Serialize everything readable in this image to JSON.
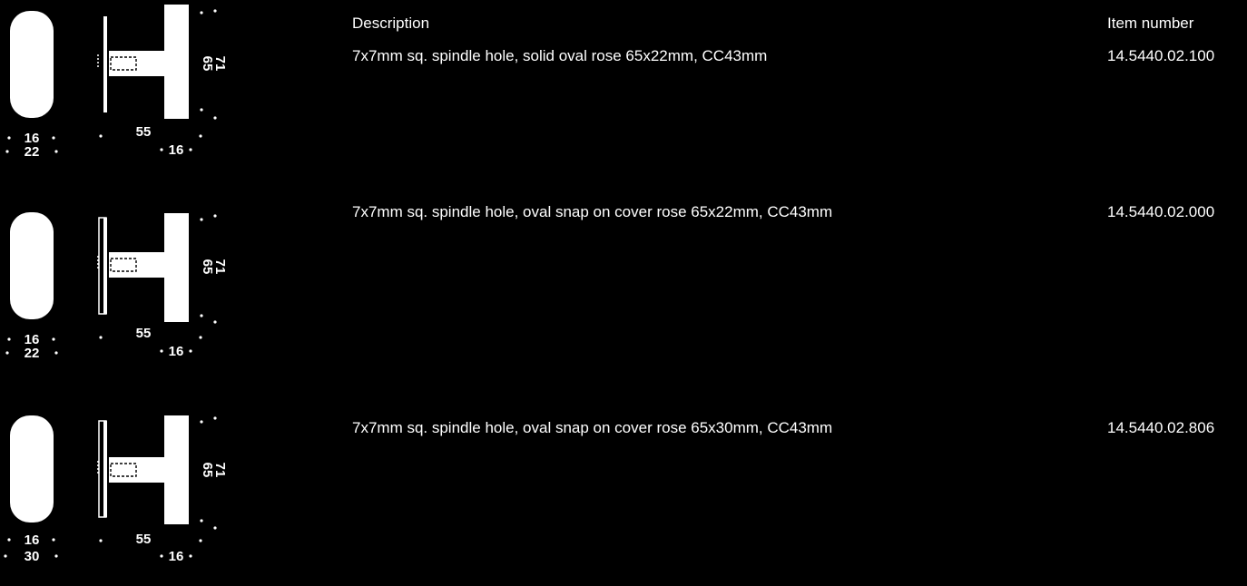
{
  "header": {
    "description_label": "Description",
    "item_number_label": "Item number"
  },
  "rows": [
    {
      "description": "7x7mm sq. spindle hole, solid oval rose 65x22mm, CC43mm",
      "item_number": "14.5440.02.100",
      "rose_type": "solid",
      "dims": {
        "rose_width": "16",
        "rose_depth": "22",
        "projection": "55",
        "base_width": "16",
        "rose_height": "65",
        "overall_height": "71"
      }
    },
    {
      "description": "7x7mm sq. spindle hole, oval snap on cover rose 65x22mm, CC43mm",
      "item_number": "14.5440.02.000",
      "rose_type": "snap-on",
      "dims": {
        "rose_width": "16",
        "rose_depth": "22",
        "projection": "55",
        "base_width": "16",
        "rose_height": "65",
        "overall_height": "71"
      }
    },
    {
      "description": "7x7mm sq. spindle hole, oval snap on cover rose 65x30mm, CC43mm",
      "item_number": "14.5440.02.806",
      "rose_type": "snap-on",
      "dims": {
        "rose_width": "16",
        "rose_depth": "30",
        "projection": "55",
        "base_width": "16",
        "rose_height": "65",
        "overall_height": "71"
      }
    }
  ]
}
